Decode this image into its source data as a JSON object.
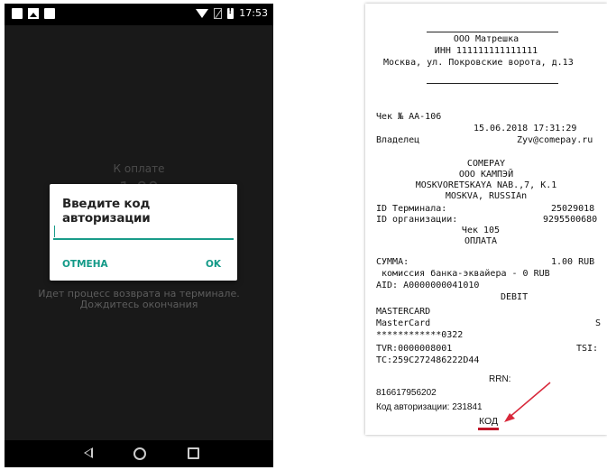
{
  "status_bar": {
    "time": "17:53"
  },
  "payment": {
    "label": "К оплате",
    "amount": "1.00",
    "process_message": "Идет процесс возврата на терминале. Дождитесь окончания"
  },
  "dialog": {
    "title": "Введите код авторизации",
    "input_value": "",
    "cancel_label": "ОТМЕНА",
    "ok_label": "OK"
  },
  "navbar": {
    "back": "back-icon",
    "home": "home-icon",
    "recent": "recent-apps-icon"
  },
  "receipt": {
    "org_name": "ООО Матрешка",
    "inn": "ИНН 111111111111111",
    "address": "Москва, ул. Покровские ворота, д.13",
    "check_no": "Чек № АА-106",
    "datetime": "15.06.2018 17:31:29",
    "owner_label": "Владелец",
    "owner_email": "Zyv@comepay.ru",
    "bank_lines": [
      "COMEPAY",
      "ООО КАМПЭЙ",
      "MOSKVORETSKAYA NAB.,7, K.1",
      "MOSKVA, RUSSIAn"
    ],
    "terminal_id_label": "ID Терминала:",
    "terminal_id": "25029018",
    "org_id_label": "ID организации:",
    "org_id": "9295500680",
    "check_105": "Чек 105",
    "payment_word": "ОПЛАТА",
    "sum_label": "СУММА:",
    "sum_value": "1.00 RUB",
    "fee_line": " комиссия банка-эквайера - 0 RUB",
    "aid": "AID: A0000000041010",
    "debit": "DEBIT",
    "card_brand_upper": "MASTERCARD",
    "card_brand": "MasterCard",
    "card_s": "S",
    "card_number": "************0322",
    "tvr": "TVR:0000008001",
    "tsi": "TSI:",
    "tc": "TC:259C272486222D44",
    "rrn_label": "RRN:",
    "rrn_value": "816617956202",
    "auth_code_line": "Код авторизации: 231841",
    "kod_label": "КОД"
  },
  "colors": {
    "accent": "#139a88",
    "highlight": "#c0182a",
    "dark_bg": "#191919"
  }
}
